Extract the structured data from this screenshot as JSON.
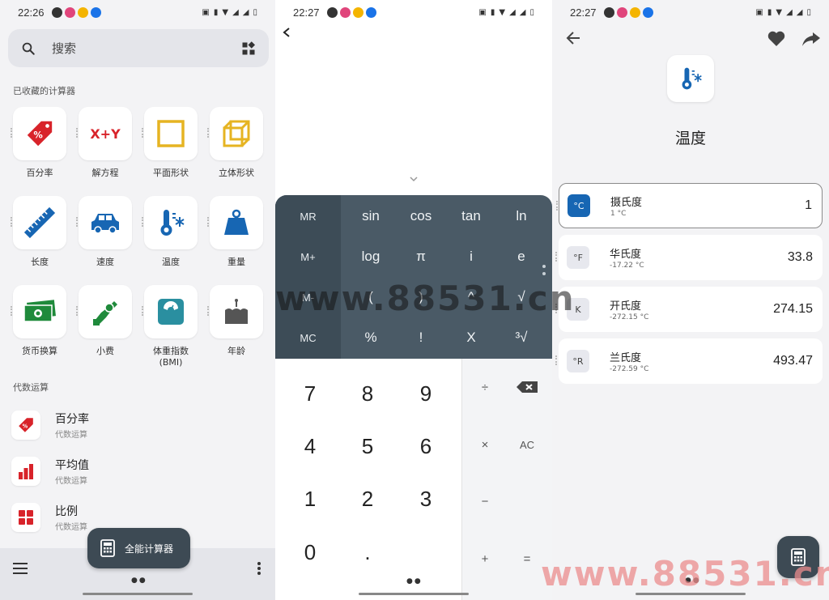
{
  "panel1": {
    "status": {
      "time": "22:26"
    },
    "search": {
      "placeholder": "搜索"
    },
    "favorites_title": "已收藏的计算器",
    "favorites": [
      {
        "label": "百分率",
        "icon": "percent-tag-icon"
      },
      {
        "label": "解方程",
        "icon": "x-plus-y-icon"
      },
      {
        "label": "平面形状",
        "icon": "square-shape-icon"
      },
      {
        "label": "立体形状",
        "icon": "cube-shape-icon"
      },
      {
        "label": "长度",
        "icon": "ruler-icon"
      },
      {
        "label": "速度",
        "icon": "car-icon"
      },
      {
        "label": "温度",
        "icon": "thermometer-icon"
      },
      {
        "label": "重量",
        "icon": "weight-icon"
      },
      {
        "label": "货币换算",
        "icon": "money-icon"
      },
      {
        "label": "小费",
        "icon": "tip-hand-icon"
      },
      {
        "label": "体重指数",
        "label2": "(BMI)",
        "icon": "scale-icon"
      },
      {
        "label": "年龄",
        "icon": "cake-icon"
      }
    ],
    "algebra_title": "代数运算",
    "algebra_items": [
      {
        "title": "百分率",
        "subtitle": "代数运算",
        "icon": "percent-tag-icon"
      },
      {
        "title": "平均值",
        "subtitle": "代数运算",
        "icon": "bar-chart-icon"
      },
      {
        "title": "比例",
        "subtitle": "代数运算",
        "icon": "grid-squares-icon"
      }
    ],
    "fab_label": "全能计算器"
  },
  "panel2": {
    "status": {
      "time": "22:27"
    },
    "memory_keys": [
      "MR",
      "M+",
      "M-",
      "MC"
    ],
    "sci_rows": [
      [
        "sin",
        "cos",
        "tan",
        "ln"
      ],
      [
        "log",
        "π",
        "i",
        "e"
      ],
      [
        "(",
        ")",
        "^",
        "√"
      ],
      [
        "%",
        "!",
        "X",
        "³√"
      ]
    ],
    "num_rows": [
      [
        "7",
        "8",
        "9"
      ],
      [
        "4",
        "5",
        "6"
      ],
      [
        "1",
        "2",
        "3"
      ],
      [
        "0",
        "."
      ]
    ],
    "ops": {
      "divide": "÷",
      "multiply": "×",
      "clear": "AC",
      "minus": "−",
      "plus": "+",
      "equals": "="
    }
  },
  "panel3": {
    "status": {
      "time": "22:27"
    },
    "title": "温度",
    "units": [
      {
        "badge": "°C",
        "name": "摄氏度",
        "sub": "1 °C",
        "value": "1",
        "active": true
      },
      {
        "badge": "°F",
        "name": "华氏度",
        "sub": "-17.22 °C",
        "value": "33.8",
        "active": false
      },
      {
        "badge": "K",
        "name": "开氏度",
        "sub": "-272.15 °C",
        "value": "274.15",
        "active": false
      },
      {
        "badge": "°R",
        "name": "兰氏度",
        "sub": "-272.59 °C",
        "value": "493.47",
        "active": false
      }
    ]
  },
  "watermarks": {
    "center": "www.88531.cn",
    "bottom": "www.88531.cn"
  },
  "colors": {
    "accent_red": "#d8232a",
    "accent_blue": "#1766b3",
    "accent_green": "#1f8a3b",
    "accent_teal": "#2a8fa0",
    "accent_yellow": "#e6b422",
    "dark_key": "#4a5a66",
    "fab": "#3d4a54"
  }
}
